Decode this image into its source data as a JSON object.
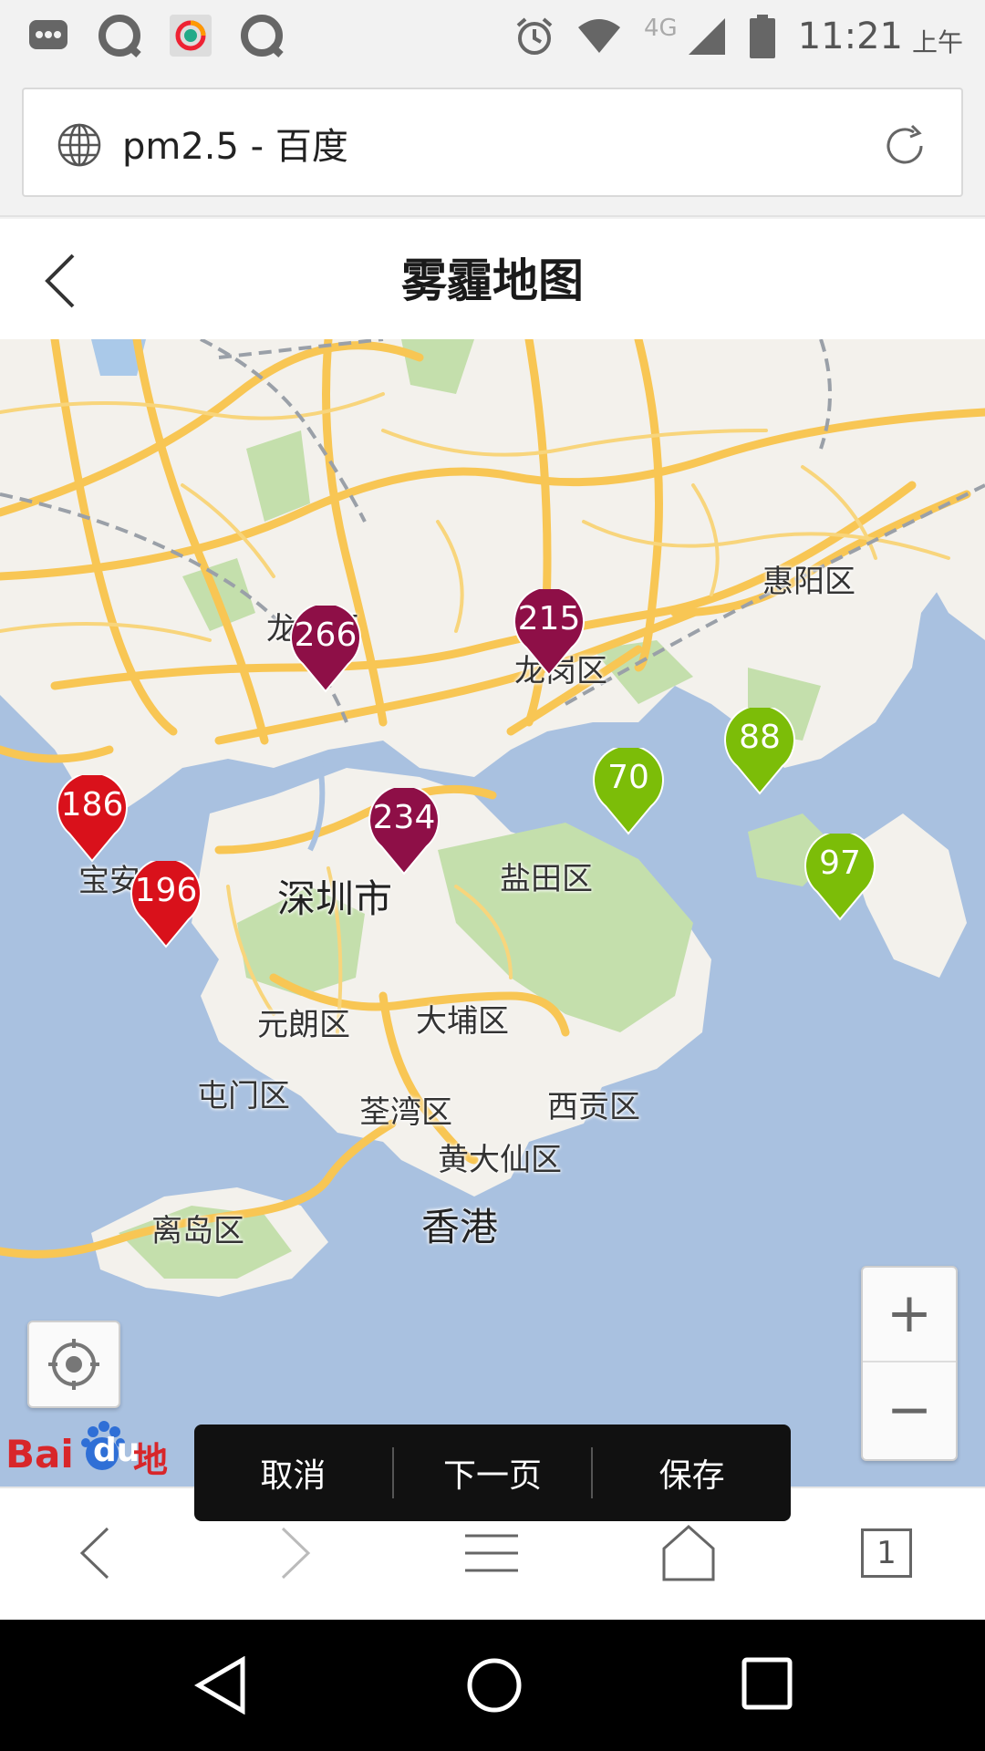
{
  "status_bar": {
    "time": "11:21",
    "ampm": "上午",
    "network": "4G",
    "icons": [
      "message-icon",
      "qq-icon",
      "app-icon",
      "qq-icon",
      "alarm-icon",
      "wifi-icon",
      "signal-icon",
      "battery-icon"
    ]
  },
  "url_bar": {
    "text": "pm2.5 - 百度"
  },
  "header": {
    "title": "雾霾地图"
  },
  "map": {
    "places": {
      "huiyang": "惠阳区",
      "longgang": "龙岗区",
      "longhua": "龙华区",
      "baoan": "宝安",
      "shenzhen": "深圳市",
      "yantian": "盐田区",
      "yuanlang": "元朗区",
      "dapu": "大埔区",
      "tunmen": "屯门区",
      "quanwan": "荃湾区",
      "xigong": "西贡区",
      "huangdaxian": "黄大仙区",
      "lidao": "离岛区",
      "hongkong": "香港"
    },
    "markers": {
      "m1": {
        "value": "266",
        "level": "severe",
        "color": "#8e0f47"
      },
      "m2": {
        "value": "215",
        "level": "severe",
        "color": "#8e0f47"
      },
      "m3": {
        "value": "234",
        "level": "severe",
        "color": "#8e0f47"
      },
      "m4": {
        "value": "186",
        "level": "heavy",
        "color": "#d9111b"
      },
      "m5": {
        "value": "196",
        "level": "heavy",
        "color": "#d9111b"
      },
      "m6": {
        "value": "70",
        "level": "good",
        "color": "#7cbd08"
      },
      "m7": {
        "value": "88",
        "level": "good",
        "color": "#7cbd08"
      },
      "m8": {
        "value": "97",
        "level": "good",
        "color": "#7cbd08"
      }
    },
    "zoom_in": "+",
    "zoom_out": "−",
    "logo": {
      "bai": "Bai",
      "du": "du",
      "cn": "地图"
    }
  },
  "action_bar": {
    "cancel": "取消",
    "next": "下一页",
    "save": "保存"
  },
  "toolbar": {
    "tab_count": "1"
  }
}
